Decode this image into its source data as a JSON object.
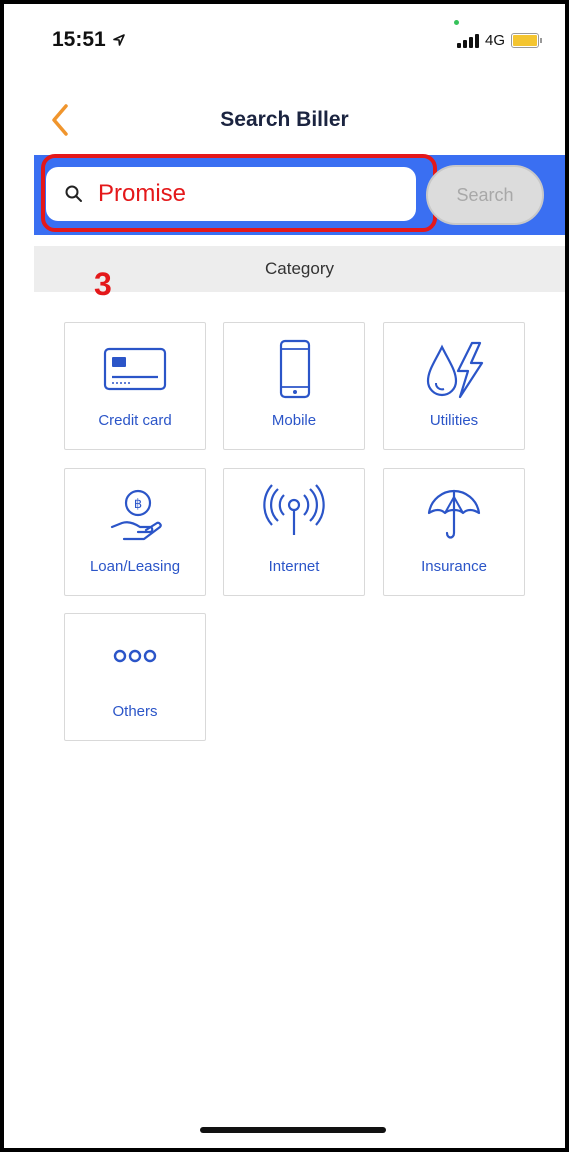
{
  "status": {
    "time": "15:51",
    "network": "4G"
  },
  "header": {
    "title": "Search Biller"
  },
  "search": {
    "value": "Promise",
    "button_label": "Search"
  },
  "category": {
    "label": "Category"
  },
  "annotation": {
    "step": "3"
  },
  "tiles": [
    {
      "label": "Credit card",
      "icon": "credit-card-icon"
    },
    {
      "label": "Mobile",
      "icon": "mobile-icon"
    },
    {
      "label": "Utilities",
      "icon": "utilities-icon"
    },
    {
      "label": "Loan/Leasing",
      "icon": "loan-icon"
    },
    {
      "label": "Internet",
      "icon": "internet-icon"
    },
    {
      "label": "Insurance",
      "icon": "insurance-icon"
    },
    {
      "label": "Others",
      "icon": "others-icon"
    }
  ],
  "colors": {
    "accent": "#3a6ff2",
    "tile_text": "#2b55c8",
    "highlight": "#e4181a",
    "back_arrow": "#f0952d"
  }
}
